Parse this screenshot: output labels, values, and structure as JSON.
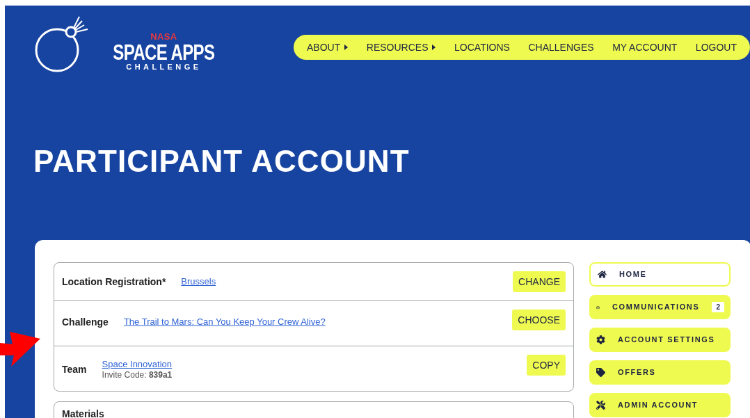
{
  "logo": {
    "agency": "NASA",
    "title": "SPACE APPS",
    "subtitle": "CHALLENGE"
  },
  "nav": [
    {
      "label": "ABOUT",
      "has_submenu": true
    },
    {
      "label": "RESOURCES",
      "has_submenu": true
    },
    {
      "label": "LOCATIONS",
      "has_submenu": false
    },
    {
      "label": "CHALLENGES",
      "has_submenu": false
    },
    {
      "label": "MY ACCOUNT",
      "has_submenu": false
    },
    {
      "label": "LOGOUT",
      "has_submenu": false
    }
  ],
  "page_title": "PARTICIPANT ACCOUNT",
  "rows": [
    {
      "label": "Location Registration*",
      "link": "Brussels",
      "button": "CHANGE"
    },
    {
      "label": "Challenge",
      "link": "The Trail to Mars: Can You Keep Your Crew Alive?",
      "button": "CHOOSE"
    },
    {
      "label": "Team",
      "link": "Space Innovation",
      "note": "Invite Code: **839a1**",
      "button": "COPY"
    }
  ],
  "materials": {
    "title": "Materials"
  },
  "sidebar": [
    {
      "label": "HOME",
      "kind": "home",
      "selected": true
    },
    {
      "label": "COMMUNICATIONS",
      "kind": "headset",
      "badge": "2",
      "selected": false
    },
    {
      "label": "ACCOUNT SETTINGS",
      "kind": "settings",
      "selected": false
    },
    {
      "label": "OFFERS",
      "kind": "offers",
      "selected": false
    },
    {
      "label": "ADMIN ACCOUNT",
      "kind": "admin",
      "selected": false
    }
  ]
}
